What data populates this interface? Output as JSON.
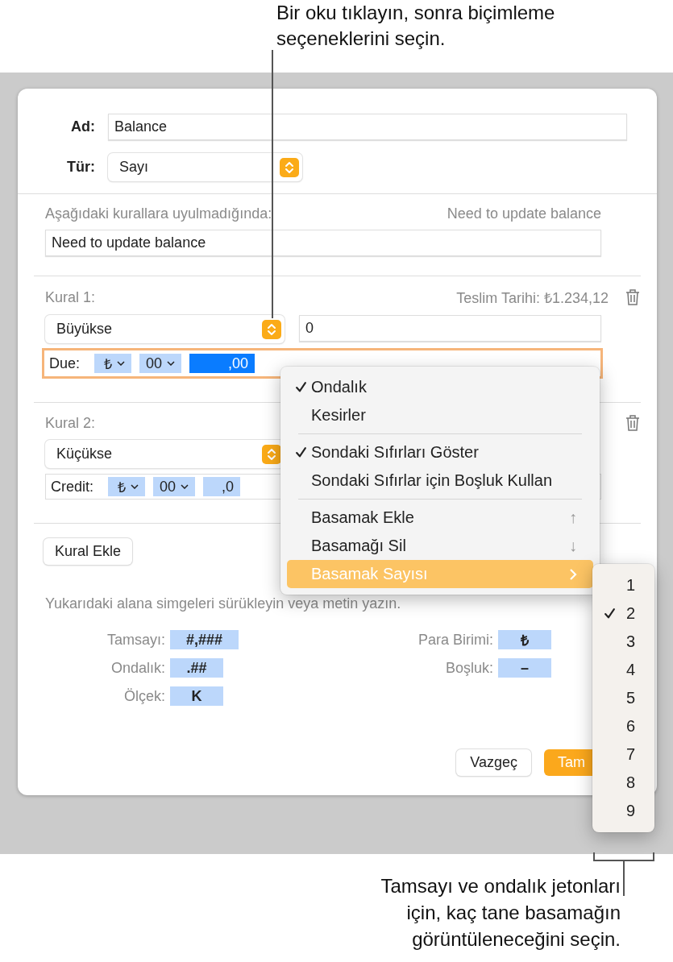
{
  "callout_top": "Bir oku tıklayın, sonra biçimleme seçeneklerini seçin.",
  "dialog": {
    "name_label": "Ad:",
    "name_value": "Balance",
    "type_label": "Tür:",
    "type_value": "Sayı",
    "fallback_label": "Aşağıdaki kurallara uyulmadığında:",
    "fallback_preview": "Need to update balance",
    "fallback_value": "Need to update balance",
    "rules": [
      {
        "label": "Kural 1:",
        "preview": "Teslim Tarihi: ₺1.234,12",
        "condition": "Büyükse",
        "value": "0",
        "format_prefix": "Due:",
        "focused": true,
        "tokens": [
          {
            "text": "₺",
            "selected": false,
            "caret": true
          },
          {
            "text": "00",
            "selected": false,
            "caret": true
          },
          {
            "text": ",00",
            "selected": true,
            "caret": false
          }
        ]
      },
      {
        "label": "Kural 2:",
        "condition": "Küçükse",
        "format_prefix": "Credit:",
        "focused": false,
        "tokens": [
          {
            "text": "₺",
            "selected": false,
            "caret": true
          },
          {
            "text": "00",
            "selected": false,
            "caret": true
          },
          {
            "text": ",0",
            "selected": false,
            "caret": false
          }
        ]
      }
    ],
    "add_rule_button": "Kural Ekle",
    "hint": "Yukarıdaki alana simgeleri sürükleyin veya metin yazın.",
    "tokens_left": [
      {
        "label": "Tamsayı:",
        "token": "#,###"
      },
      {
        "label": "Ondalık:",
        "token": ".##"
      },
      {
        "label": "Ölçek:",
        "token": "K"
      }
    ],
    "tokens_right": [
      {
        "label": "Para Birimi:",
        "token": "₺"
      },
      {
        "label": "Boşluk:",
        "token": "–"
      }
    ],
    "buttons": [
      {
        "label": "Vazgeç",
        "kind": "secondary"
      },
      {
        "label": "Tam",
        "kind": "primary"
      }
    ]
  },
  "format_menu": {
    "items": [
      {
        "kind": "item",
        "label": "Ondalık",
        "checked": true,
        "highlighted": false
      },
      {
        "kind": "item",
        "label": "Kesirler",
        "checked": false,
        "highlighted": false
      },
      {
        "kind": "separator"
      },
      {
        "kind": "item",
        "label": "Sondaki Sıfırları Göster",
        "checked": true,
        "highlighted": false
      },
      {
        "kind": "item",
        "label": "Sondaki Sıfırlar için Boşluk Kullan",
        "checked": false,
        "highlighted": false
      },
      {
        "kind": "separator"
      },
      {
        "kind": "item",
        "label": "Basamak Ekle",
        "checked": false,
        "highlighted": false,
        "shortcut": "↑"
      },
      {
        "kind": "item",
        "label": "Basamağı Sil",
        "checked": false,
        "highlighted": false,
        "shortcut": "↓"
      },
      {
        "kind": "submenu",
        "label": "Basamak Sayısı",
        "checked": false,
        "highlighted": true
      }
    ]
  },
  "digits_menu": {
    "items": [
      {
        "label": "1",
        "checked": false
      },
      {
        "label": "2",
        "checked": true
      },
      {
        "label": "3",
        "checked": false
      },
      {
        "label": "4",
        "checked": false
      },
      {
        "label": "5",
        "checked": false
      },
      {
        "label": "6",
        "checked": false
      },
      {
        "label": "7",
        "checked": false
      },
      {
        "label": "8",
        "checked": false
      },
      {
        "label": "9",
        "checked": false
      }
    ]
  },
  "callout_bottom": "Tamsayı ve ondalık jetonları için, kaç tane basamağın görüntüleneceğini seçin."
}
